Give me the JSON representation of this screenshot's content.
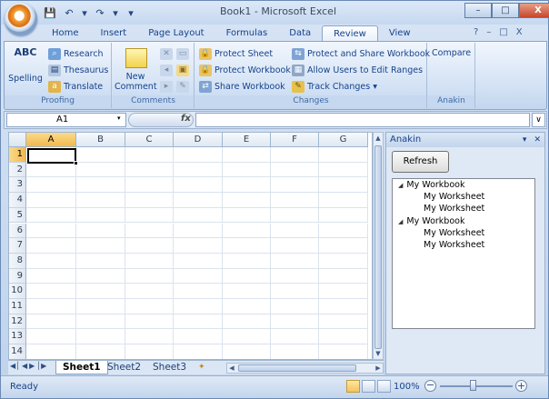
{
  "window": {
    "doc_name": "Book1",
    "separator": " - ",
    "app_name": "Microsoft Excel",
    "controls": {
      "minimize": "–",
      "maximize": "□",
      "close": "X"
    }
  },
  "qat": {
    "save": "💾",
    "undo": "↶",
    "undo_menu": "▾",
    "redo": "↷",
    "redo_menu": "▾",
    "customize": "▾"
  },
  "ribbon_tabs": [
    {
      "label": "Home"
    },
    {
      "label": "Insert"
    },
    {
      "label": "Page Layout"
    },
    {
      "label": "Formulas"
    },
    {
      "label": "Data"
    },
    {
      "label": "Review"
    },
    {
      "label": "View"
    }
  ],
  "ribbon_right": {
    "help": "?",
    "min": "–",
    "restore": "□",
    "close": "X"
  },
  "groups": {
    "proofing": {
      "label": "Proofing",
      "spelling": "Spelling",
      "spelling_icon": "ABC",
      "research": "Research",
      "thesaurus": "Thesaurus",
      "translate": "Translate"
    },
    "comments": {
      "label": "Comments",
      "new_comment": "New",
      "new_comment_2": "Comment"
    },
    "changes": {
      "label": "Changes",
      "protect_sheet": "Protect Sheet",
      "protect_workbook": "Protect Workbook",
      "share_workbook": "Share Workbook",
      "protect_share": "Protect and Share Workbook",
      "allow_users": "Allow Users to Edit Ranges",
      "track_changes": "Track Changes",
      "track_arrow": "▾"
    },
    "anakin": {
      "label": "Anakin",
      "compare": "Compare"
    }
  },
  "formula_bar": {
    "name_box": "A1",
    "dropdown": "▾",
    "fx": "fx",
    "formula": "",
    "expand": "∨"
  },
  "grid": {
    "columns": [
      "A",
      "B",
      "C",
      "D",
      "E",
      "F",
      "G"
    ],
    "rows": [
      "1",
      "2",
      "3",
      "4",
      "5",
      "6",
      "7",
      "8",
      "9",
      "10",
      "11",
      "12",
      "13",
      "14"
    ],
    "selected": "A1"
  },
  "sheet_tabs": {
    "nav": [
      "◀│",
      "◀",
      "▶",
      "│▶"
    ],
    "tabs": [
      {
        "label": "Sheet1"
      },
      {
        "label": "Sheet2"
      },
      {
        "label": "Sheet3"
      }
    ],
    "insert_icon": "✦"
  },
  "pane": {
    "title": "Anakin",
    "menu": "▾",
    "close": "✕",
    "refresh": "Refresh",
    "tree": [
      {
        "label": "My Workbook",
        "children": [
          "My Worksheet",
          "My Worksheet"
        ]
      },
      {
        "label": "My Workbook",
        "children": [
          "My Worksheet",
          "My Worksheet"
        ]
      }
    ],
    "expanded_icon": "◢"
  },
  "status": {
    "text": "Ready",
    "zoom": "100%",
    "minus": "−",
    "plus": "+"
  }
}
